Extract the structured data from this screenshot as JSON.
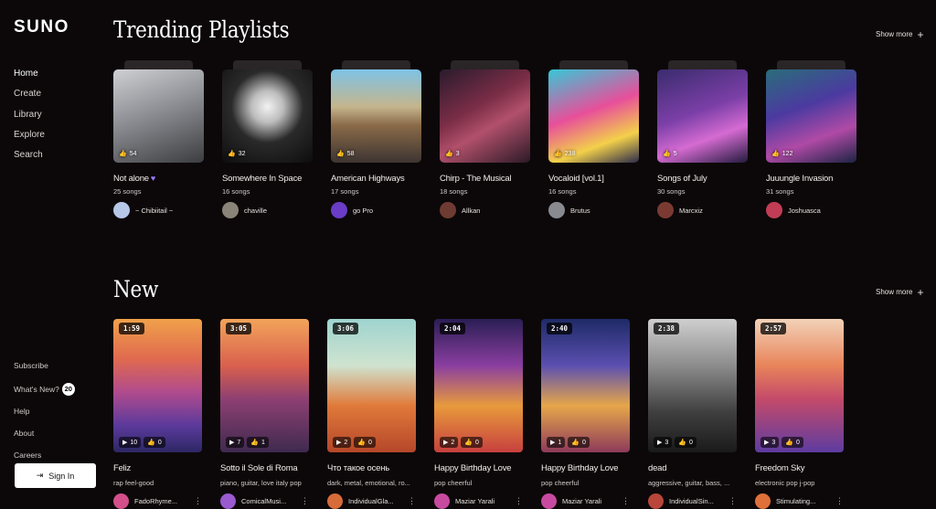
{
  "logo": "SUNO",
  "nav": [
    {
      "label": "Home"
    },
    {
      "label": "Create"
    },
    {
      "label": "Library"
    },
    {
      "label": "Explore"
    },
    {
      "label": "Search"
    }
  ],
  "footer": {
    "subscribe": "Subscribe",
    "whats_new": "What's New?",
    "whats_new_count": "20",
    "help": "Help",
    "about": "About",
    "careers": "Careers"
  },
  "sign_in": "Sign In",
  "trending": {
    "title": "Trending Playlists",
    "show_more": "Show more",
    "playlists": [
      {
        "name": "Not alone",
        "heart": "♥",
        "songs": "25 songs",
        "likes": "54",
        "author": "~ Chibiitail ~",
        "art": "linear-gradient(160deg,#cfd0d3 0%,#8d8f94 45%,#3c3d40 100%)",
        "avatar": "#b7c7e8"
      },
      {
        "name": "Somewhere In Space",
        "heart": "",
        "songs": "16 songs",
        "likes": "32",
        "author": "chaville",
        "art": "radial-gradient(circle at 50% 40%,#f2f2f2 0%,#bdbdbd 22%,#2a2a2a 50%,#0d0d0d 100%)",
        "avatar": "#8a8478"
      },
      {
        "name": "American Highways",
        "heart": "",
        "songs": "17 songs",
        "likes": "58",
        "author": "go Pro",
        "art": "linear-gradient(180deg,#7ec3e6 0%,#c5b58d 40%,#8a6a48 60%,#3d3532 100%)",
        "avatar": "#6a3cc7"
      },
      {
        "name": "Chirp - The Musical",
        "heart": "",
        "songs": "18 songs",
        "likes": "3",
        "author": "Allkan",
        "art": "linear-gradient(150deg,#2a1b2d 0%,#7a2d46 40%,#b2506c 60%,#2b1a26 100%)",
        "avatar": "#6e3b32"
      },
      {
        "name": "Vocaloid [vol.1]",
        "heart": "",
        "songs": "16 songs",
        "likes": "238",
        "author": "Brutus",
        "art": "linear-gradient(160deg,#36c8d8 0%,#e84f9a 45%,#f3d04a 75%,#2b2b4a 100%)",
        "avatar": "#888a90"
      },
      {
        "name": "Songs of July",
        "heart": "",
        "songs": "30 songs",
        "likes": "5",
        "author": "Marcxiz",
        "art": "linear-gradient(160deg,#3a2c6e 0%,#7b3fa7 45%,#d56bd2 70%,#231b3e 100%)",
        "avatar": "#7a3a32"
      },
      {
        "name": "Juuungle Invasion",
        "heart": "",
        "songs": "31 songs",
        "likes": "122",
        "author": "Joshuasca",
        "art": "linear-gradient(160deg,#2a6d7a 0%,#4b3aa0 40%,#b04aa6 70%,#1c2444 100%)",
        "avatar": "#c13d55"
      }
    ]
  },
  "new": {
    "title": "New",
    "show_more": "Show more",
    "songs": [
      {
        "name": "Feliz",
        "tags": "rap feel-good",
        "duration": "1:59",
        "plays": "10",
        "likes": "0",
        "author": "FadoRhyme...",
        "art": "linear-gradient(180deg,#f0a14a 0%,#e06a4f 30%,#b04b8d 55%,#5b3a9c 80%,#2d2764 100%)",
        "avatar": "#d24f8a"
      },
      {
        "name": "Sotto il Sole di Roma",
        "tags": "piano, guitar, love italy pop",
        "duration": "3:05",
        "plays": "7",
        "likes": "1",
        "author": "ComicalMusi...",
        "art": "linear-gradient(180deg,#f2a45a 0%,#d9604e 35%,#8e4072 60%,#3e2a4f 100%)",
        "avatar": "#9a5ad0"
      },
      {
        "name": "Что такое осень",
        "tags": "dark, metal, emotional, ro...",
        "duration": "3:06",
        "plays": "2",
        "likes": "0",
        "author": "IndividualGla...",
        "art": "linear-gradient(180deg,#9ed4cf 0%,#cfe3cf 35%,#e07a3a 65%,#b5472a 100%)",
        "avatar": "#d76b3a"
      },
      {
        "name": "Happy Birthday Love",
        "tags": "pop cheerful",
        "duration": "2:04",
        "plays": "2",
        "likes": "0",
        "author": "Maziar Yarali",
        "art": "linear-gradient(180deg,#2a1e54 0%,#8a3ea0 35%,#e89a3c 65%,#c7403e 100%)",
        "avatar": "#c74aa0"
      },
      {
        "name": "Happy Birthday Love",
        "tags": "pop cheerful",
        "duration": "2:40",
        "plays": "1",
        "likes": "0",
        "author": "Maziar Yarali",
        "art": "linear-gradient(180deg,#1e2a66 0%,#5b4fb0 35%,#e6a64a 65%,#8e3a5a 100%)",
        "avatar": "#c74aa0"
      },
      {
        "name": "dead",
        "tags": "aggressive, guitar, bass, ...",
        "duration": "2:38",
        "plays": "3",
        "likes": "0",
        "author": "IndividualSin...",
        "art": "linear-gradient(180deg,#cfcfcf 0%,#8c8c8c 35%,#3f3f3f 70%,#1a1a1a 100%)",
        "avatar": "#b8463a"
      },
      {
        "name": "Freedom Sky",
        "tags": "electronic pop j-pop",
        "duration": "2:57",
        "plays": "3",
        "likes": "0",
        "author": "Stimulating...",
        "art": "linear-gradient(180deg,#f2d2b8 0%,#e8845a 35%,#c44a6a 60%,#5d3ca0 100%)",
        "avatar": "#e0703a"
      }
    ]
  }
}
